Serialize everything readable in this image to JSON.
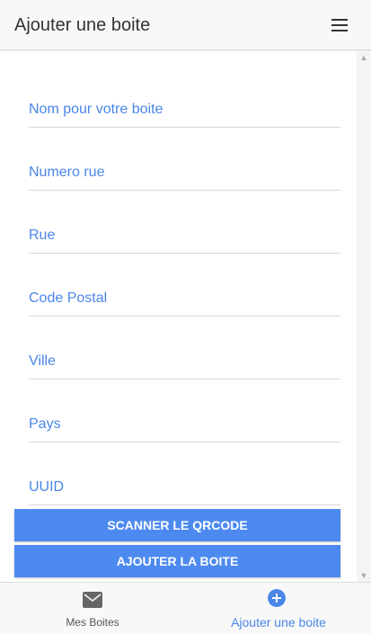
{
  "header": {
    "title": "Ajouter une boite"
  },
  "form": {
    "name_placeholder": "Nom pour votre boite",
    "street_number_placeholder": "Numero rue",
    "street_placeholder": "Rue",
    "postal_code_placeholder": "Code Postal",
    "city_placeholder": "Ville",
    "country_placeholder": "Pays",
    "uuid_placeholder": "UUID"
  },
  "buttons": {
    "scan_label": "SCANNER LE QRCODE",
    "add_label": "AJOUTER LA BOITE"
  },
  "tabs": [
    {
      "label": "Mes Boites",
      "icon": "mail-icon",
      "active": false
    },
    {
      "label": "Ajouter une boite",
      "icon": "add-circle-icon",
      "active": true
    }
  ],
  "colors": {
    "accent": "#4a86e8",
    "button": "#4d8af0",
    "header_bg": "#f8f8f8",
    "text_dark": "#333333"
  }
}
